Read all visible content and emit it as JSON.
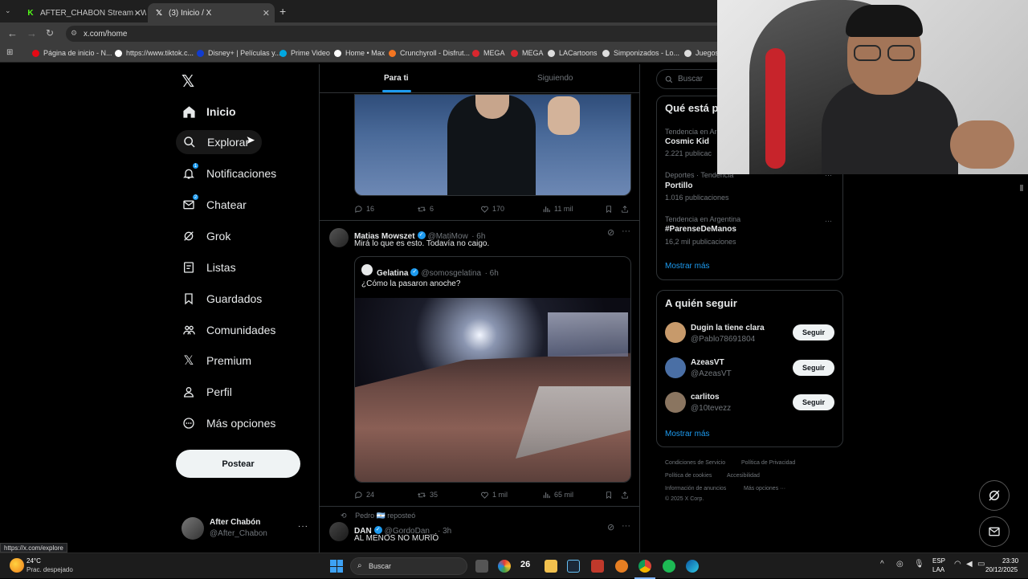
{
  "browser": {
    "tabs": [
      {
        "title": "AFTER_CHABON Stream - Watc",
        "active": false
      },
      {
        "title": "(3) Inicio / X",
        "active": true
      }
    ],
    "url": "x.com/home",
    "bookmarks": [
      {
        "label": "Página de inicio - N...",
        "color": "#e50914"
      },
      {
        "label": "https://www.tiktok.c...",
        "color": "#ffffff"
      },
      {
        "label": "Disney+ | Películas y...",
        "color": "#113ccf"
      },
      {
        "label": "Prime Video",
        "color": "#00a8e1"
      },
      {
        "label": "Home • Max",
        "color": "#ffffff"
      },
      {
        "label": "Crunchyroll - Disfrut...",
        "color": "#f47521"
      },
      {
        "label": "MEGA",
        "color": "#d9272e"
      },
      {
        "label": "MEGA",
        "color": "#d9272e"
      },
      {
        "label": "LACartoons",
        "color": "#ffffff"
      },
      {
        "label": "Simponizados - Lo...",
        "color": "#ffffff"
      },
      {
        "label": "Juegos",
        "color": "#ffffff"
      }
    ],
    "status_url": "https://x.com/explore"
  },
  "nav": {
    "items": [
      {
        "label": "Inicio",
        "icon": "home-icon",
        "active": true
      },
      {
        "label": "Explorar",
        "icon": "search-icon"
      },
      {
        "label": "Notificaciones",
        "icon": "bell-icon",
        "badge": "1"
      },
      {
        "label": "Chatear",
        "icon": "mail-icon",
        "badge": "2"
      },
      {
        "label": "Grok",
        "icon": "grok-icon"
      },
      {
        "label": "Listas",
        "icon": "list-icon"
      },
      {
        "label": "Guardados",
        "icon": "bookmark-icon"
      },
      {
        "label": "Comunidades",
        "icon": "communities-icon"
      },
      {
        "label": "Premium",
        "icon": "x-logo-icon"
      },
      {
        "label": "Perfil",
        "icon": "profile-icon"
      },
      {
        "label": "Más opciones",
        "icon": "more-icon"
      }
    ],
    "post_button": "Postear",
    "account": {
      "name": "After Chabón",
      "handle": "@After_Chabon"
    }
  },
  "feed": {
    "tabs": [
      "Para ti",
      "Siguiendo"
    ],
    "tweet1_actions": {
      "replies": "16",
      "reposts": "6",
      "likes": "170",
      "views": "11 mil"
    },
    "tweet2": {
      "name": "Matias Mowszet",
      "handle": "@MatiMow",
      "time": "· 6h",
      "text": "Mirá lo que es esto. Todavía no caigo.",
      "quote": {
        "name": "Gelatina",
        "handle": "@somosgelatina",
        "time": "· 6h",
        "text": "¿Cómo la pasaron anoche?"
      },
      "actions": {
        "replies": "24",
        "reposts": "35",
        "likes": "1 mil",
        "views": "65 mil"
      }
    },
    "tweet3": {
      "repost_label": "Pedro 🇦🇷 reposteó",
      "name": "DAN",
      "handle": "@GordoDan_",
      "time": "· 3h",
      "text": "AL MENOS NO MURIÓ"
    }
  },
  "sidebar": {
    "search_placeholder": "Buscar",
    "trends_title": "Qué está p",
    "trends": [
      {
        "meta": "Tendencia en Ar",
        "name": "Cosmic Kid",
        "count": "2.221 publicac"
      },
      {
        "meta": "Deportes · Tendencia",
        "name": "Portillo",
        "count": "1.016 publicaciones"
      },
      {
        "meta": "Tendencia en Argentina",
        "name": "#ParenseDeManos",
        "count": "16,2 mil publicaciones"
      }
    ],
    "trends_more": "Mostrar más",
    "follow_title": "A quién seguir",
    "follow": [
      {
        "name": "Dugin la tiene clara",
        "handle": "@Pablo78691804",
        "button": "Seguir",
        "color": "#c79a6b"
      },
      {
        "name": "AzeasVT",
        "handle": "@AzeasVT",
        "button": "Seguir",
        "color": "#4a6fa5"
      },
      {
        "name": "carlitos",
        "handle": "@10tevezz",
        "button": "Seguir",
        "color": "#8a7560"
      }
    ],
    "follow_more": "Mostrar más",
    "footer": [
      "Condiciones de Servicio",
      "Política de Privacidad",
      "Política de cookies",
      "Accesibilidad",
      "Información de anuncios",
      "Más opciones ···",
      "© 2025 X Corp."
    ]
  },
  "taskbar": {
    "weather_temp": "24°C",
    "weather_desc": "Prac. despejado",
    "search_label": "Buscar",
    "calendar_num": "26",
    "lang_top": "ESP",
    "lang_bottom": "LAA",
    "time": "23:30",
    "date": "20/12/2025"
  },
  "colors": {
    "accent": "#1d9bf0",
    "background": "#000000",
    "border": "#2f3336",
    "muted": "#71767b"
  }
}
